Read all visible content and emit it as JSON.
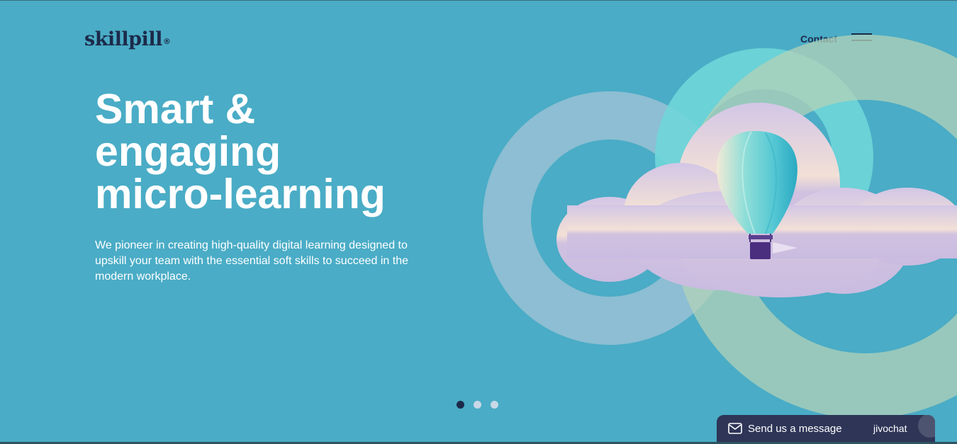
{
  "header": {
    "logo_text": "skillpill",
    "logo_mark": "®",
    "contact_label": "Contact",
    "menu_icon": "hamburger-menu-icon"
  },
  "hero": {
    "headline": [
      "Smart &",
      "engaging",
      "micro-learning"
    ],
    "subtitle": "We pioneer in creating high-quality digital learning designed to upskill your team with the essential soft skills to succeed in the modern workplace.",
    "illustration": "hot-air-balloon-clouds"
  },
  "carousel": {
    "total": 3,
    "active": 1
  },
  "chat_widget": {
    "label": "Send us a message",
    "brand": "jivochat",
    "icon": "envelope-icon"
  },
  "colors": {
    "background": "#4aacc6",
    "brand_dark": "#1c2a4a",
    "headline": "#ffffff",
    "chat_bg": "#2e3557",
    "dot_inactive": "#c9d8e6"
  }
}
